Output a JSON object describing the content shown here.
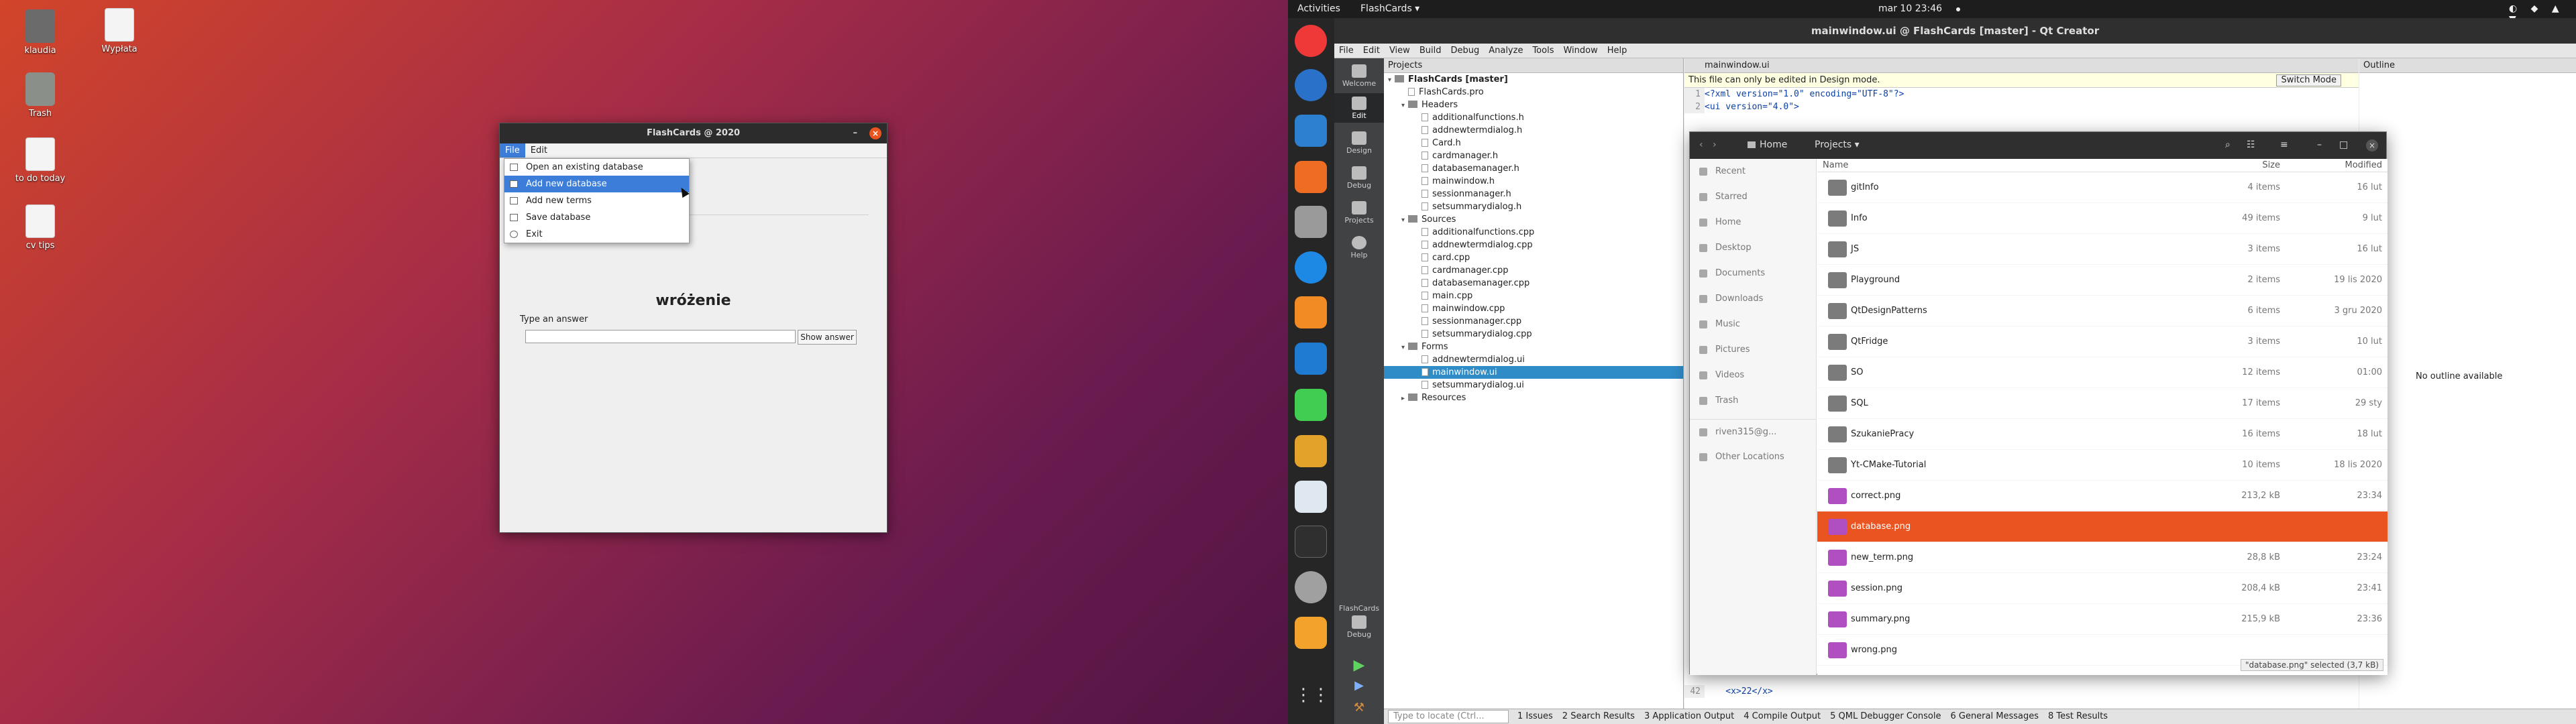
{
  "desktop": {
    "icons": [
      {
        "label": "klaudia"
      },
      {
        "label": "Wypłata"
      },
      {
        "label": "Trash"
      },
      {
        "label": "to do today"
      },
      {
        "label": "cv tips"
      }
    ]
  },
  "flashcards": {
    "title": "FlashCards @ 2020",
    "menubar": [
      "File",
      "Edit"
    ],
    "file_menu": [
      "Open an existing database",
      "Add new database",
      "Add new terms",
      "Save database",
      "Exit"
    ],
    "highlighted_menu_item": "Add new database",
    "word": "wróżenie",
    "answer_label": "Type an answer",
    "answer_value": "",
    "show_answer": "Show answer"
  },
  "topbar": {
    "activities": "Activities",
    "app": "FlashCards ▾",
    "clock": "mar 10  23:46"
  },
  "qt": {
    "title": "mainwindow.ui @ FlashCards [master] - Qt Creator",
    "menu": [
      "File",
      "Edit",
      "View",
      "Build",
      "Debug",
      "Analyze",
      "Tools",
      "Window",
      "Help"
    ],
    "modes": [
      "Welcome",
      "Edit",
      "Design",
      "Debug",
      "Projects",
      "Help"
    ],
    "kit_label": "FlashCards",
    "kit_mode": "Debug",
    "projects_header": "Projects",
    "tree": [
      {
        "t": "FlashCards [master]",
        "lvl": 0,
        "kind": "root"
      },
      {
        "t": "FlashCards.pro",
        "lvl": 1,
        "kind": "file"
      },
      {
        "t": "Headers",
        "lvl": 1,
        "kind": "folder"
      },
      {
        "t": "additionalfunctions.h",
        "lvl": 2,
        "kind": "file"
      },
      {
        "t": "addnewtermdialog.h",
        "lvl": 2,
        "kind": "file"
      },
      {
        "t": "Card.h",
        "lvl": 2,
        "kind": "file"
      },
      {
        "t": "cardmanager.h",
        "lvl": 2,
        "kind": "file"
      },
      {
        "t": "databasemanager.h",
        "lvl": 2,
        "kind": "file"
      },
      {
        "t": "mainwindow.h",
        "lvl": 2,
        "kind": "file"
      },
      {
        "t": "sessionmanager.h",
        "lvl": 2,
        "kind": "file"
      },
      {
        "t": "setsummarydialog.h",
        "lvl": 2,
        "kind": "file"
      },
      {
        "t": "Sources",
        "lvl": 1,
        "kind": "folder"
      },
      {
        "t": "additionalfunctions.cpp",
        "lvl": 2,
        "kind": "file"
      },
      {
        "t": "addnewtermdialog.cpp",
        "lvl": 2,
        "kind": "file"
      },
      {
        "t": "card.cpp",
        "lvl": 2,
        "kind": "file"
      },
      {
        "t": "cardmanager.cpp",
        "lvl": 2,
        "kind": "file"
      },
      {
        "t": "databasemanager.cpp",
        "lvl": 2,
        "kind": "file"
      },
      {
        "t": "main.cpp",
        "lvl": 2,
        "kind": "file"
      },
      {
        "t": "mainwindow.cpp",
        "lvl": 2,
        "kind": "file"
      },
      {
        "t": "sessionmanager.cpp",
        "lvl": 2,
        "kind": "file"
      },
      {
        "t": "setsummarydialog.cpp",
        "lvl": 2,
        "kind": "file"
      },
      {
        "t": "Forms",
        "lvl": 1,
        "kind": "folder"
      },
      {
        "t": "addnewtermdialog.ui",
        "lvl": 2,
        "kind": "file"
      },
      {
        "t": "mainwindow.ui",
        "lvl": 2,
        "kind": "file",
        "selected": true
      },
      {
        "t": "setsummarydialog.ui",
        "lvl": 2,
        "kind": "file"
      },
      {
        "t": "Resources",
        "lvl": 1,
        "kind": "folder"
      }
    ],
    "editor_tab": "mainwindow.ui",
    "design_note": "This file can only be edited in Design mode.",
    "switch_mode": "Switch Mode",
    "code_lines": [
      {
        "n": "1",
        "t": "<?xml version=\"1.0\" encoding=\"UTF-8\"?>"
      },
      {
        "n": "2",
        "t": "<ui version=\"4.0\">"
      },
      {
        "n": "42",
        "t": "    <x>22</x>"
      }
    ],
    "outline_header": "Outline",
    "no_outline": "No outline available",
    "locator_placeholder": "Type to locate (Ctrl...",
    "status_tabs": [
      "1 Issues",
      "2 Search Results",
      "3 Application Output",
      "4 Compile Output",
      "5 QML Debugger Console",
      "6 General Messages",
      "8 Test Results"
    ]
  },
  "files": {
    "path": [
      "Home",
      "Projects ▾"
    ],
    "sidebar": [
      "Recent",
      "Starred",
      "Home",
      "Desktop",
      "Documents",
      "Downloads",
      "Music",
      "Pictures",
      "Videos",
      "Trash",
      "riven315@g...",
      "Other Locations"
    ],
    "columns": [
      "Name",
      "Size",
      "Modified"
    ],
    "rows": [
      {
        "name": "gitInfo",
        "size": "4 items",
        "mod": "16 lut",
        "kind": "folder"
      },
      {
        "name": "Info",
        "size": "49 items",
        "mod": "9 lut",
        "kind": "folder"
      },
      {
        "name": "JS",
        "size": "3 items",
        "mod": "16 lut",
        "kind": "folder"
      },
      {
        "name": "Playground",
        "size": "2 items",
        "mod": "19 lis 2020",
        "kind": "folder"
      },
      {
        "name": "QtDesignPatterns",
        "size": "6 items",
        "mod": "3 gru 2020",
        "kind": "folder"
      },
      {
        "name": "QtFridge",
        "size": "3 items",
        "mod": "10 lut",
        "kind": "folder"
      },
      {
        "name": "SO",
        "size": "12 items",
        "mod": "01:00",
        "kind": "folder"
      },
      {
        "name": "SQL",
        "size": "17 items",
        "mod": "29 sty",
        "kind": "folder"
      },
      {
        "name": "SzukaniePracy",
        "size": "16 items",
        "mod": "18 lut",
        "kind": "folder"
      },
      {
        "name": "Yt-CMake-Tutorial",
        "size": "10 items",
        "mod": "18 lis 2020",
        "kind": "folder"
      },
      {
        "name": "correct.png",
        "size": "213,2 kB",
        "mod": "23:34",
        "kind": "image"
      },
      {
        "name": "database.png",
        "size": "",
        "mod": "",
        "kind": "image",
        "selected": true
      },
      {
        "name": "new_term.png",
        "size": "28,8 kB",
        "mod": "23:24",
        "kind": "image"
      },
      {
        "name": "session.png",
        "size": "208,4 kB",
        "mod": "23:41",
        "kind": "image"
      },
      {
        "name": "summary.png",
        "size": "215,9 kB",
        "mod": "23:36",
        "kind": "image"
      },
      {
        "name": "wrong.png",
        "size": "",
        "mod": "",
        "kind": "image"
      }
    ],
    "selection_info": "\"database.png\" selected (3,7 kB)"
  },
  "colors": {
    "ubuntu_orange": "#e95420",
    "qt_select": "#308cc6",
    "menu_highlight": "#3b7dd8"
  }
}
